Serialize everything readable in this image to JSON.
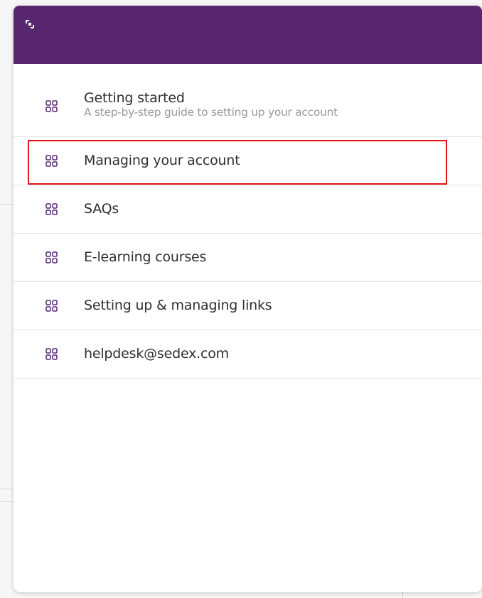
{
  "colors": {
    "header": "#57266e",
    "icon": "#57266e",
    "highlight": "#e3141b"
  },
  "header": {
    "collapse_icon": "collapse-icon"
  },
  "menu": {
    "items": [
      {
        "label": "Getting started",
        "subtitle": "A step-by-step guide to setting up your account",
        "icon": "grid-icon"
      },
      {
        "label": "Managing your account",
        "icon": "grid-icon",
        "highlighted": true
      },
      {
        "label": "SAQs",
        "icon": "grid-icon"
      },
      {
        "label": "E-learning courses",
        "icon": "grid-icon"
      },
      {
        "label": "Setting up & managing links",
        "icon": "grid-icon"
      },
      {
        "label": "helpdesk@sedex.com",
        "icon": "grid-icon"
      }
    ]
  }
}
